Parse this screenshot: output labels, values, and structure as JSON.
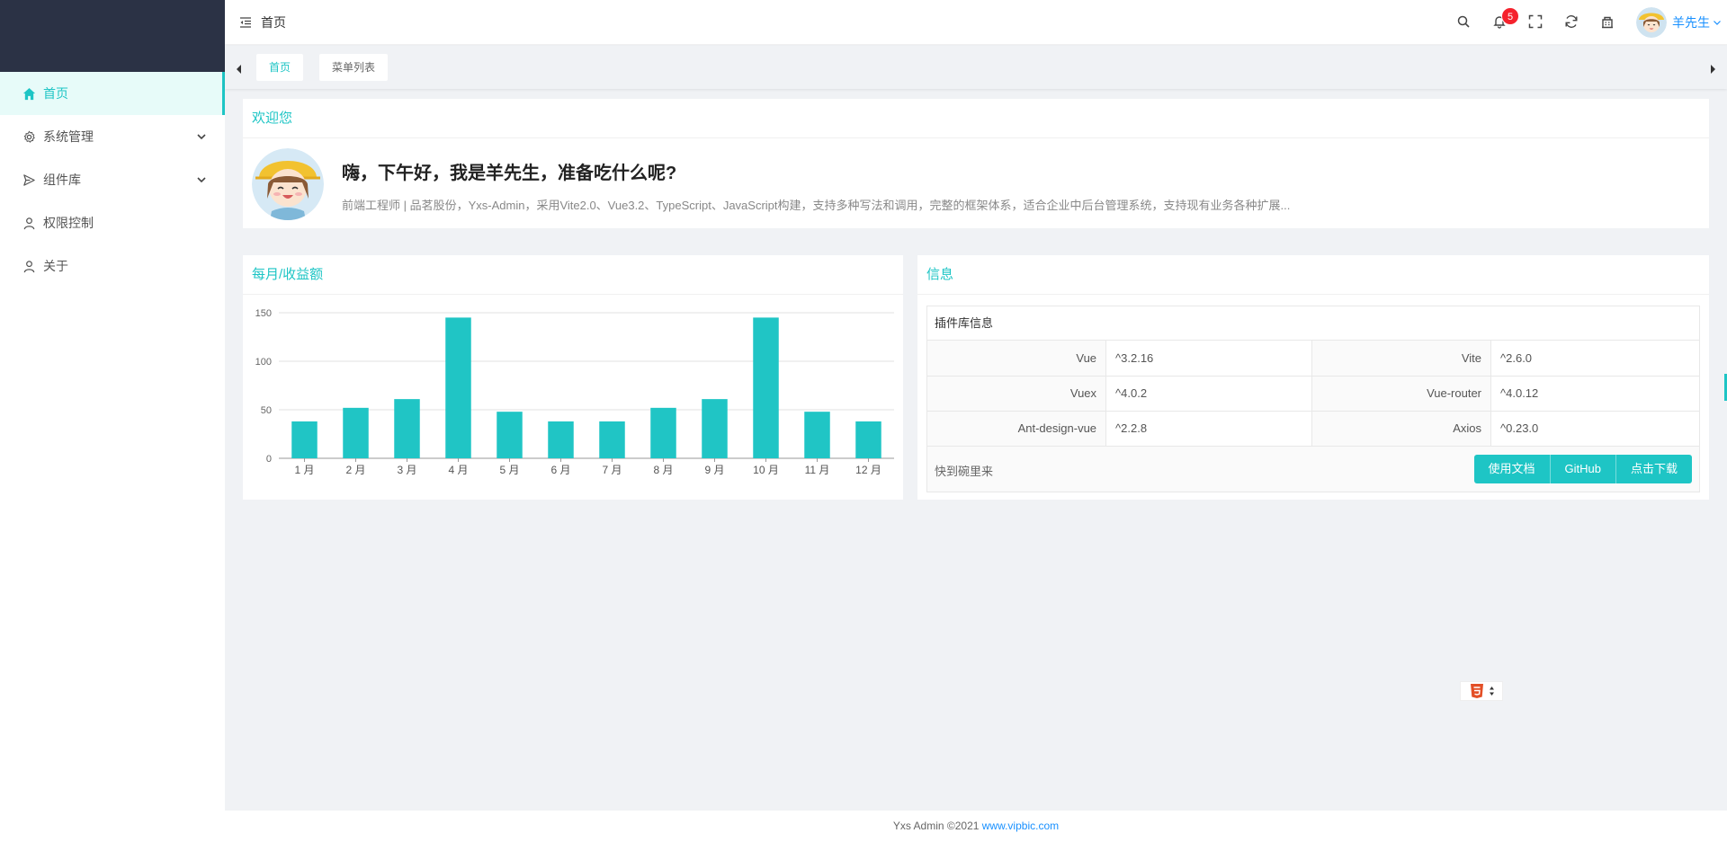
{
  "header": {
    "breadcrumb": "首页",
    "notification_count": "5",
    "user_name": "羊先生",
    "icons": [
      "search-icon",
      "bell-icon",
      "fullscreen-icon",
      "refresh-icon",
      "building-icon"
    ]
  },
  "sidebar": {
    "items": [
      {
        "label": "首页",
        "icon": "home-icon",
        "active": true
      },
      {
        "label": "系统管理",
        "icon": "gear-icon",
        "expandable": true
      },
      {
        "label": "组件库",
        "icon": "send-icon",
        "expandable": true
      },
      {
        "label": "权限控制",
        "icon": "user-icon"
      },
      {
        "label": "关于",
        "icon": "user-icon"
      }
    ]
  },
  "tabs": [
    {
      "label": "首页",
      "active": true
    },
    {
      "label": "菜单列表",
      "active": false
    }
  ],
  "welcome": {
    "title": "欢迎您",
    "greeting": "嗨，下午好，我是羊先生，准备吃什么呢?",
    "description": "前端工程师 | 品茗股份，Yxs-Admin，采用Vite2.0、Vue3.2、TypeScript、JavaScript构建，支持多种写法和调用，完整的框架体系，适合企业中后台管理系统，支持现有业务各种扩展..."
  },
  "chart_card": {
    "title": "每月/收益额"
  },
  "chart_data": {
    "type": "bar",
    "categories": [
      "1 月",
      "2 月",
      "3 月",
      "4 月",
      "5 月",
      "6 月",
      "7 月",
      "8 月",
      "9 月",
      "10 月",
      "11 月",
      "12 月"
    ],
    "values": [
      38,
      52,
      61,
      145,
      48,
      38,
      38,
      52,
      61,
      145,
      48,
      38
    ],
    "yticks": [
      "0",
      "50",
      "100",
      "150"
    ],
    "ylim": [
      0,
      150
    ],
    "grid": true,
    "bar_color": "#20c5c5"
  },
  "info": {
    "title": "信息",
    "table_title": "插件库信息",
    "rows": [
      {
        "l1": "Vue",
        "v1": "^3.2.16",
        "l2": "Vite",
        "v2": "^2.6.0"
      },
      {
        "l1": "Vuex",
        "v1": "^4.0.2",
        "l2": "Vue-router",
        "v2": "^4.0.12"
      },
      {
        "l1": "Ant-design-vue",
        "v1": "^2.2.8",
        "l2": "Axios",
        "v2": "^0.23.0"
      }
    ],
    "footer_text": "快到碗里来",
    "buttons": [
      "使用文档",
      "GitHub",
      "点击下载"
    ]
  },
  "footer": {
    "text": "Yxs Admin ©2021 ",
    "link": "www.vipbic.com"
  },
  "colors": {
    "accent": "#1ec5c5",
    "sidebar_logo_bg": "#2b3245",
    "link": "#1890ff",
    "badge": "#f5222d"
  }
}
